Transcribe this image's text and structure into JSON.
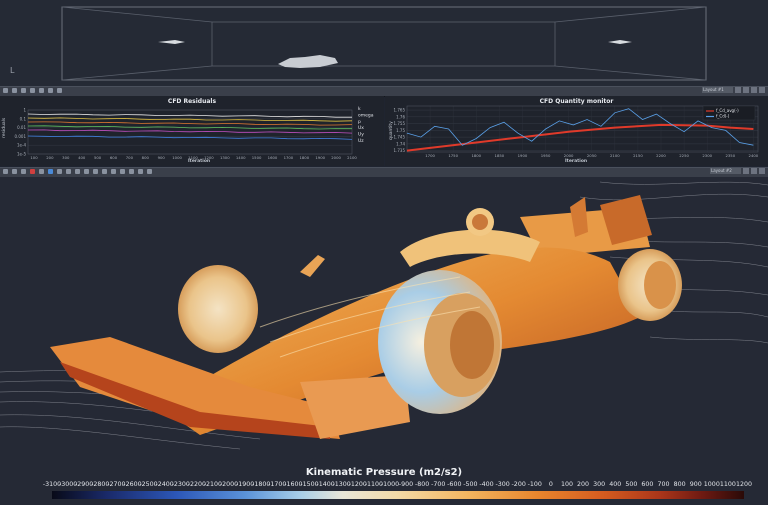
{
  "top_view": {
    "axis_glyph": "L"
  },
  "toolbar_top": {
    "layout_combo": "Layout #1"
  },
  "toolbar_mid": {
    "layout_combo": "Layout #2"
  },
  "residuals": {
    "title": "CFD Residuals",
    "xlabel": "Iteration",
    "ylabel": "residuals",
    "legend": [
      "k",
      "omega",
      "p",
      "Ux",
      "Uy",
      "Uz"
    ]
  },
  "monitor": {
    "title": "CFD Quantity monitor",
    "xlabel": "Iteration",
    "ylabel": "quantity",
    "legend": [
      "f_Cd_avg(-)",
      "f_Cd(-)"
    ]
  },
  "chart_data": [
    {
      "type": "line",
      "title": "CFD Residuals",
      "xlabel": "Iteration",
      "ylabel": "residuals",
      "x_ticks": [
        "100",
        "200",
        "300",
        "400",
        "500",
        "600",
        "700",
        "800",
        "900",
        "1000",
        "1100",
        "1200",
        "1300",
        "1400",
        "1500",
        "1600",
        "1700",
        "1800",
        "1900",
        "2000",
        "2100"
      ],
      "y_ticks": [
        "1",
        "0.1",
        "0.01",
        "0.001",
        "1e-4",
        "1e-5"
      ],
      "series": [
        {
          "name": "k",
          "color": "#e8e8e8"
        },
        {
          "name": "omega",
          "color": "#e0c040"
        },
        {
          "name": "p",
          "color": "#e07a30"
        },
        {
          "name": "Ux",
          "color": "#60c060"
        },
        {
          "name": "Uy",
          "color": "#c050c0"
        },
        {
          "name": "Uz",
          "color": "#4080e0"
        }
      ]
    },
    {
      "type": "line",
      "title": "CFD Quantity monitor",
      "xlabel": "Iteration",
      "ylabel": "quantity",
      "x_ticks": [
        "1700",
        "1750",
        "1800",
        "1850",
        "1900",
        "1950",
        "2000",
        "2050",
        "2100",
        "2150",
        "2200",
        "2250",
        "2300",
        "2350",
        "2400"
      ],
      "y_ticks": [
        "1.765",
        "1.76",
        "1.755",
        "1.75",
        "1.745",
        "1.74",
        "1.735"
      ],
      "ylim": [
        1.734,
        1.768
      ],
      "series": [
        {
          "name": "f_Cd_avg(-)",
          "color": "#e03a2a",
          "x": [
            1650,
            1700,
            1800,
            1900,
            2000,
            2100,
            2200,
            2300,
            2350,
            2400
          ],
          "values": [
            1.735,
            1.737,
            1.741,
            1.745,
            1.749,
            1.752,
            1.754,
            1.7535,
            1.752,
            1.751
          ]
        },
        {
          "name": "f_Cd(-)",
          "color": "#5aa0e8",
          "x": [
            1650,
            1680,
            1710,
            1740,
            1770,
            1800,
            1830,
            1860,
            1890,
            1920,
            1950,
            1980,
            2010,
            2040,
            2070,
            2100,
            2130,
            2160,
            2190,
            2220,
            2250,
            2280,
            2310,
            2340,
            2370,
            2400
          ],
          "values": [
            1.748,
            1.745,
            1.753,
            1.751,
            1.739,
            1.744,
            1.752,
            1.756,
            1.748,
            1.742,
            1.751,
            1.757,
            1.754,
            1.758,
            1.753,
            1.763,
            1.766,
            1.758,
            1.762,
            1.755,
            1.749,
            1.757,
            1.752,
            1.75,
            1.741,
            1.739
          ]
        }
      ]
    }
  ],
  "colorbar": {
    "title": "Kinematic Pressure (m2/s2)",
    "ticks": [
      "-3100",
      "-3000",
      "-2900",
      "-2800",
      "-2700",
      "-2600",
      "-2500",
      "-2400",
      "-2300",
      "-2200",
      "-2100",
      "-2000",
      "-1900",
      "-1800",
      "-1700",
      "-1600",
      "-1500",
      "-1400",
      "-1300",
      "-1200",
      "-1100",
      "-1000",
      "-900",
      "-800",
      "-700",
      "-600",
      "-500",
      "-400",
      "-300",
      "-200",
      "-100",
      "0",
      "100",
      "200",
      "300",
      "400",
      "500",
      "600",
      "700",
      "800",
      "900",
      "1000",
      "1100",
      "1200"
    ]
  }
}
